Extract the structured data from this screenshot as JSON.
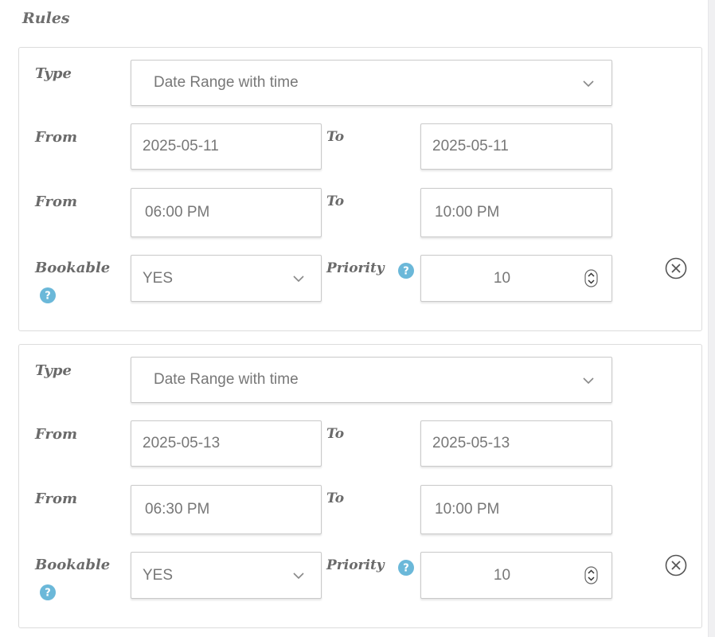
{
  "section_title": "Rules",
  "rules": [
    {
      "type_label": "Type",
      "type_value": "Date Range with time",
      "date_from_label": "From",
      "date_from": "2025-05-11",
      "date_to_label": "To",
      "date_to": "2025-05-11",
      "time_from_label": "From",
      "time_from": "06:00 PM",
      "time_to_label": "To",
      "time_to": "10:00 PM",
      "bookable_label": "Bookable",
      "bookable_value": "YES",
      "priority_label": "Priority",
      "priority_value": "10"
    },
    {
      "type_label": "Type",
      "type_value": "Date Range with time",
      "date_from_label": "From",
      "date_from": "2025-05-13",
      "date_to_label": "To",
      "date_to": "2025-05-13",
      "time_from_label": "From",
      "time_from": "06:30 PM",
      "time_to_label": "To",
      "time_to": "10:00 PM",
      "bookable_label": "Bookable",
      "bookable_value": "YES",
      "priority_label": "Priority",
      "priority_value": "10"
    }
  ],
  "icons": {
    "help": "help-icon",
    "remove": "close-circle-icon",
    "dropdown": "chevron-down-icon",
    "spinner": "spinner-icon"
  },
  "colors": {
    "help_icon": "#6bb8d9",
    "label_text": "#6a6a6a",
    "field_text": "#777777",
    "border": "#c9c9c9"
  }
}
